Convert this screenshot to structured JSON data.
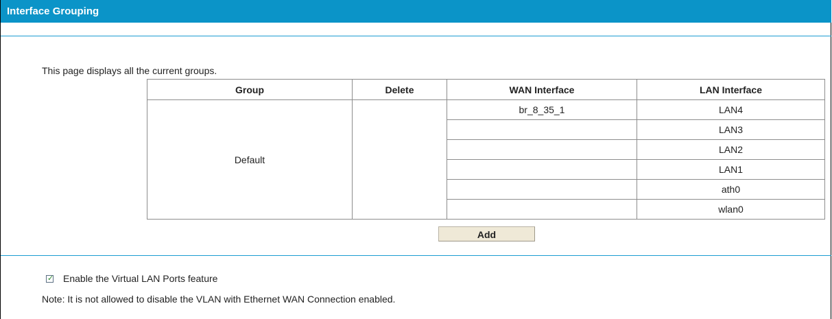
{
  "header": {
    "title": "Interface Grouping"
  },
  "intro_text": "This page displays all the current groups.",
  "table": {
    "columns": [
      "Group",
      "Delete",
      "WAN Interface",
      "LAN Interface"
    ],
    "group_name": "Default",
    "wan_interfaces": [
      "br_8_35_1",
      "",
      "",
      "",
      "",
      ""
    ],
    "lan_interfaces": [
      "LAN4",
      "LAN3",
      "LAN2",
      "LAN1",
      "ath0",
      "wlan0"
    ]
  },
  "add_button": {
    "label": "Add"
  },
  "vlan": {
    "checked": true,
    "label": "Enable the Virtual LAN Ports feature"
  },
  "note": "Note: It is not allowed to disable the VLAN with Ethernet WAN Connection enabled.",
  "colors": {
    "header_bg": "#0b94c8",
    "rule": "#1a9cd2",
    "button_bg": "#efe9d7"
  }
}
